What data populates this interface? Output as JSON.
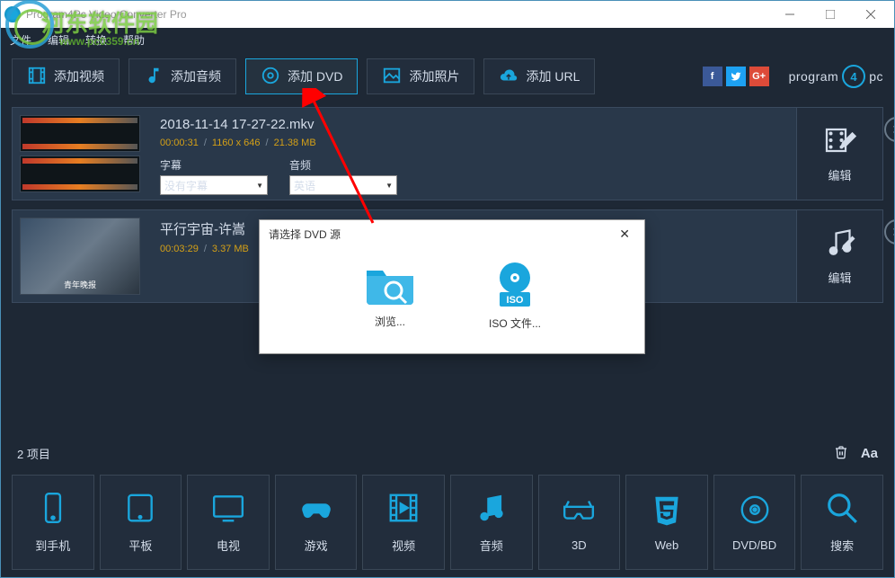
{
  "titlebar": {
    "title": "Program4Pc Video Converter Pro"
  },
  "menubar": {
    "file": "文件",
    "edit": "编辑",
    "convert": "转换",
    "help": "帮助"
  },
  "toolbar": {
    "add_video": "添加视频",
    "add_audio": "添加音频",
    "add_dvd": "添加 DVD",
    "add_photo": "添加照片",
    "add_url": "添加 URL"
  },
  "brand": {
    "prefix": "program",
    "num": "4",
    "suffix": "pc"
  },
  "files": [
    {
      "name": "2018-11-14 17-27-22.mkv",
      "duration": "00:00:31",
      "resolution": "1160 x 646",
      "size": "21.38 MB",
      "subtitle_label": "字幕",
      "subtitle_value": "没有字幕",
      "audio_label": "音频",
      "audio_value": "英语",
      "edit_label": "编辑"
    },
    {
      "name": "平行宇宙-许嵩",
      "duration": "00:03:29",
      "size": "3.37 MB",
      "thumb_caption": "青年晚报",
      "edit_label": "编辑"
    }
  ],
  "modal": {
    "title": "请选择 DVD 源",
    "browse": "浏览...",
    "iso": "ISO 文件...",
    "iso_badge": "ISO"
  },
  "status": {
    "count": "2 项目"
  },
  "categories": {
    "phone": "到手机",
    "tablet": "平板",
    "tv": "电视",
    "game": "游戏",
    "video": "视频",
    "audio": "音频",
    "threed": "3D",
    "web": "Web",
    "dvd": "DVD/BD",
    "search": "搜索"
  },
  "watermark": {
    "text": "河东软件园",
    "url": "www.pc0359.cn"
  }
}
